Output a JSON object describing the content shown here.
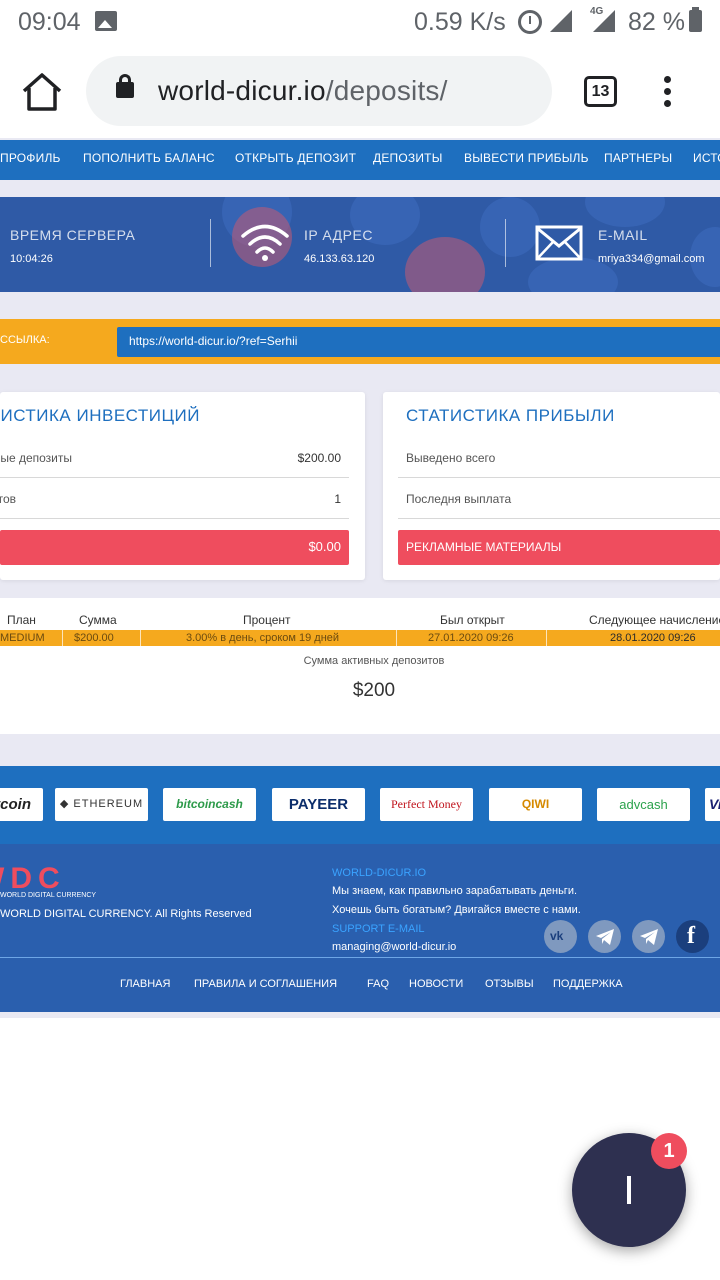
{
  "status_bar": {
    "time": "09:04",
    "net_speed": "0.59 K/s",
    "network_type": "4G",
    "battery": "82 %"
  },
  "browser": {
    "url_host": "world-dicur.io",
    "url_path": "/deposits/",
    "tab_count": "13"
  },
  "nav": {
    "items": [
      "ПРОФИЛЬ",
      "ПОПОЛНИТЬ БАЛАНС",
      "ОТКРЫТЬ ДЕПОЗИТ",
      "ДЕПОЗИТЫ",
      "ВЫВЕСТИ ПРИБЫЛЬ",
      "ПАРТНЕРЫ",
      "ИСТОРИЯ"
    ]
  },
  "server_info": {
    "time_label": "ВРЕМЯ СЕРВЕРА",
    "time_value": "10:04:26",
    "ip_label": "IP АДРЕС",
    "ip_value": "46.133.63.120",
    "email_label": "E-MAIL",
    "email_value": "mriya334@gmail.com"
  },
  "referral": {
    "label": "ССЫЛКА:",
    "link": "https://world-dicur.io/?ref=Serhii"
  },
  "investment_stats": {
    "title": "СТАТИСТИКА ИНВЕСТИЦИЙ",
    "rows": [
      {
        "label": "Активные депозиты",
        "value": "$200.00"
      },
      {
        "label": "Всего депозитов",
        "value": "1"
      }
    ],
    "balance_button": "$0.00"
  },
  "profit_stats": {
    "title": "СТАТИСТИКА ПРИБЫЛИ",
    "rows": [
      {
        "label": "Выведено всего",
        "value": ""
      },
      {
        "label": "Последня выплата",
        "value": ""
      }
    ],
    "promo_button": "РЕКЛАМНЫЕ МАТЕРИАЛЫ"
  },
  "deposits_table": {
    "headers": [
      "План",
      "Сумма",
      "Процент",
      "Был открыт",
      "Следующее начисление"
    ],
    "rows": [
      {
        "plan": "MEDIUM",
        "amount": "$200.00",
        "percent": "3.00% в день, сроком 19 дней",
        "opened": "27.01.2020 09:26",
        "next": "28.01.2020 09:26"
      }
    ],
    "total_label": "Сумма активных депозитов",
    "total_value": "$200"
  },
  "payment_systems": [
    "bitcoin",
    "ETHEREUM",
    "bitcoincash",
    "PAYEER",
    "Perfect Money",
    "QIWI",
    "advcash",
    "Visa"
  ],
  "footer": {
    "logo_text": "WDC",
    "logo_sub": "WORLD DIGITAL CURRENCY",
    "rights": "WORLD DIGITAL CURRENCY. All Rights Reserved",
    "site_heading": "WORLD-DICUR.IO",
    "slogan_1": "Мы знаем, как правильно зарабатывать деньги.",
    "slogan_2": "Хочешь быть богатым? Двигайся вместе с нами.",
    "support_heading": "SUPPORT E-MAIL",
    "support_email": "managing@world-dicur.io",
    "nav": [
      "ГЛАВНАЯ",
      "ПРАВИЛА И СОГЛАШЕНИЯ",
      "FAQ",
      "НОВОСТИ",
      "ОТЗЫВЫ",
      "ПОДДЕРЖКА"
    ]
  },
  "chat_widget": {
    "badge_count": "1"
  },
  "colors": {
    "primary_blue": "#1e6fbf",
    "accent_orange": "#f5a91e",
    "accent_red": "#ef4d5e",
    "footer_blue": "#2a5fae"
  }
}
